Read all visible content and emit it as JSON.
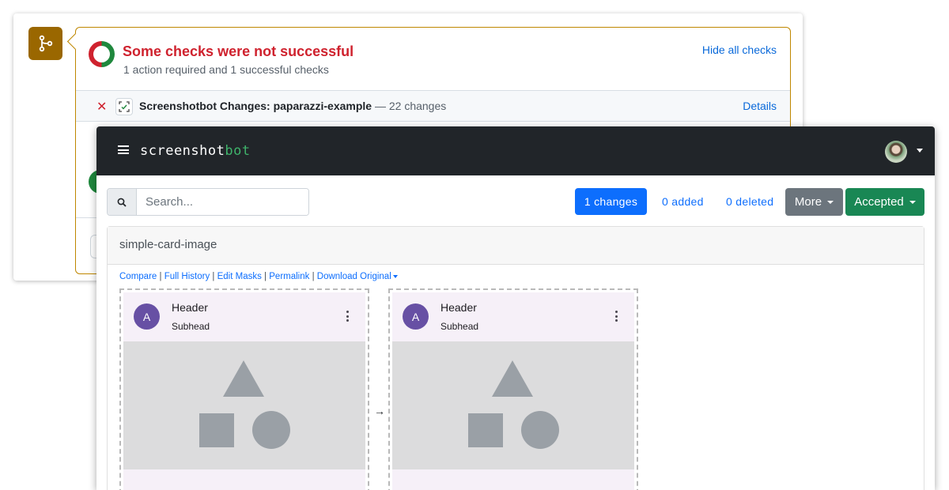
{
  "github": {
    "title": "Some checks were not successful",
    "subtitle": "1 action required and 1 successful checks",
    "hide_all": "Hide all checks",
    "check": {
      "name": "Screenshotbot Changes: paparazzi-example",
      "desc": " — 22 changes",
      "details": "Details"
    },
    "colors": {
      "fail": "#cf222e",
      "success": "#1f883d",
      "badge": "#9a6700"
    }
  },
  "app": {
    "brand_main": "screenshot",
    "brand_accent": "bot",
    "search_placeholder": "Search...",
    "changes_label": "1 changes",
    "added_label": "0 added",
    "deleted_label": "0 deleted",
    "more_label": "More",
    "accepted_label": "Accepted",
    "card_title": "simple-card-image",
    "links": {
      "compare": "Compare",
      "full_history": "Full History",
      "edit_masks": "Edit Masks",
      "permalink": "Permalink",
      "download": "Download Original",
      "sep": " | "
    },
    "preview": {
      "avatar_letter": "A",
      "header": "Header",
      "subhead": "Subhead"
    },
    "arrow": "→",
    "colors": {
      "navbar": "#212529",
      "primary": "#0d6efd",
      "success": "#198754",
      "secondary": "#6c757d"
    }
  }
}
